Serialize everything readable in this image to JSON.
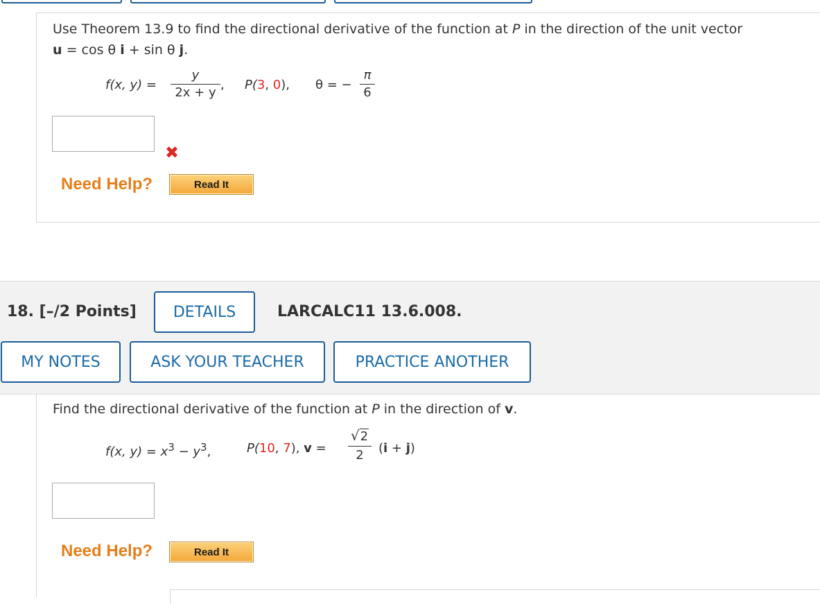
{
  "q17": {
    "line1": "Use Theorem 13.9 to find the directional derivative of the function at P in the direction of the unit vector",
    "line1_pre": "Use Theorem 13.9 to find the directional derivative of the function at ",
    "line1_p": "P",
    "line1_post": " in the direction of the unit vector",
    "unit_vector": {
      "u": "u",
      "eq": " = cos θ",
      "i": "i",
      "plus": " + sin θ",
      "j": "j",
      "period": "."
    },
    "func_label": "f(x, y) =",
    "frac_num": "y",
    "frac_den": "2x + y",
    "comma": ",",
    "point_pre": "P(",
    "point_a": "3",
    "point_sep": ", ",
    "point_b": "0",
    "point_post": "),",
    "theta_label": "θ = −",
    "theta_num": "π",
    "theta_den": "6",
    "need_help": "Need Help?",
    "read_it": "Read It",
    "status_icon": "x-mark-icon"
  },
  "q18": {
    "number": "18.  [–/2 Points]",
    "details": "DETAILS",
    "code": "LARCALC11 13.6.008.",
    "my_notes": "MY NOTES",
    "ask_teacher": "ASK YOUR TEACHER",
    "practice_another": "PRACTICE ANOTHER",
    "prompt_pre": "Find the directional derivative of the function at ",
    "prompt_p": "P",
    "prompt_mid": " in the direction of ",
    "prompt_v": "v",
    "prompt_end": ".",
    "func": "f(x, y) = x",
    "exp3": "3",
    "minus_y": " − y",
    "exp3b": "3",
    "comma": ",",
    "point_pre": "P(",
    "point_a": "10",
    "point_sep": ", ",
    "point_b": "7",
    "point_post": "), ",
    "v_label": "v",
    "v_eq": " =",
    "sqrt_num": "2",
    "frac_den": "2",
    "ij_open": "(",
    "i": "i",
    "ij_plus": " + ",
    "j": "j",
    "ij_close": ")",
    "need_help": "Need Help?",
    "read_it": "Read It"
  },
  "colors": {
    "accent": "#1a5c9a",
    "link": "#1a6aa6",
    "help": "#e47f1a",
    "red": "#e0261f"
  }
}
